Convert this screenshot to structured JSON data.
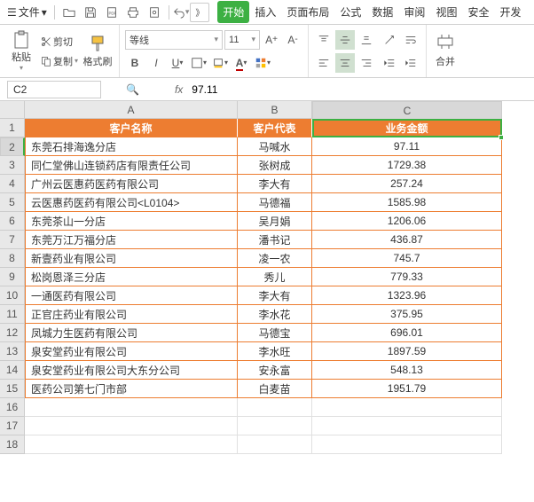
{
  "menubar": {
    "file_label": "文件",
    "overflow": "》",
    "tabs": [
      "开始",
      "插入",
      "页面布局",
      "公式",
      "数据",
      "审阅",
      "视图",
      "安全",
      "开发"
    ]
  },
  "ribbon": {
    "cut_label": "剪切",
    "copy_label": "复制",
    "paste_label": "粘贴",
    "fmt_label": "格式刷",
    "font_name": "等线",
    "font_size": "11",
    "merge_label": "合并"
  },
  "formula_bar": {
    "cell_ref": "C2",
    "fx": "fx",
    "value": "97.11"
  },
  "sheet": {
    "col_letters": [
      "A",
      "B",
      "C"
    ],
    "row_numbers": [
      "1",
      "2",
      "3",
      "4",
      "5",
      "6",
      "7",
      "8",
      "9",
      "10",
      "11",
      "12",
      "13",
      "14",
      "15",
      "16",
      "17",
      "18"
    ],
    "headers": [
      "客户名称",
      "客户代表",
      "业务金额"
    ],
    "rows": [
      {
        "name": "东莞石排海逸分店",
        "rep": "马喊水",
        "amt": "97.11"
      },
      {
        "name": "同仁堂佛山连锁药店有限责任公司",
        "rep": "张树成",
        "amt": "1729.38"
      },
      {
        "name": "广州云医惠药医药有限公司",
        "rep": "李大有",
        "amt": "257.24"
      },
      {
        "name": "云医惠药医药有限公司<L0104>",
        "rep": "马德福",
        "amt": "1585.98"
      },
      {
        "name": "东莞茶山一分店",
        "rep": "吴月娟",
        "amt": "1206.06"
      },
      {
        "name": "东莞万江万福分店",
        "rep": "潘书记",
        "amt": "436.87"
      },
      {
        "name": "新壹药业有限公司",
        "rep": "凌一农",
        "amt": "745.7"
      },
      {
        "name": "松岗恩泽三分店",
        "rep": "秀儿",
        "amt": "779.33"
      },
      {
        "name": "一通医药有限公司",
        "rep": "李大有",
        "amt": "1323.96"
      },
      {
        "name": "正官庄药业有限公司",
        "rep": "李水花",
        "amt": "375.95"
      },
      {
        "name": "凤城力生医药有限公司",
        "rep": "马德宝",
        "amt": "696.01"
      },
      {
        "name": "泉安堂药业有限公司",
        "rep": "李水旺",
        "amt": "1897.59"
      },
      {
        "name": "泉安堂药业有限公司大东分公司",
        "rep": "安永富",
        "amt": "548.13"
      },
      {
        "name": "医药公司第七门市部",
        "rep": "白麦苗",
        "amt": "1951.79"
      }
    ],
    "active_cell": {
      "row": 2,
      "col": "C"
    }
  }
}
